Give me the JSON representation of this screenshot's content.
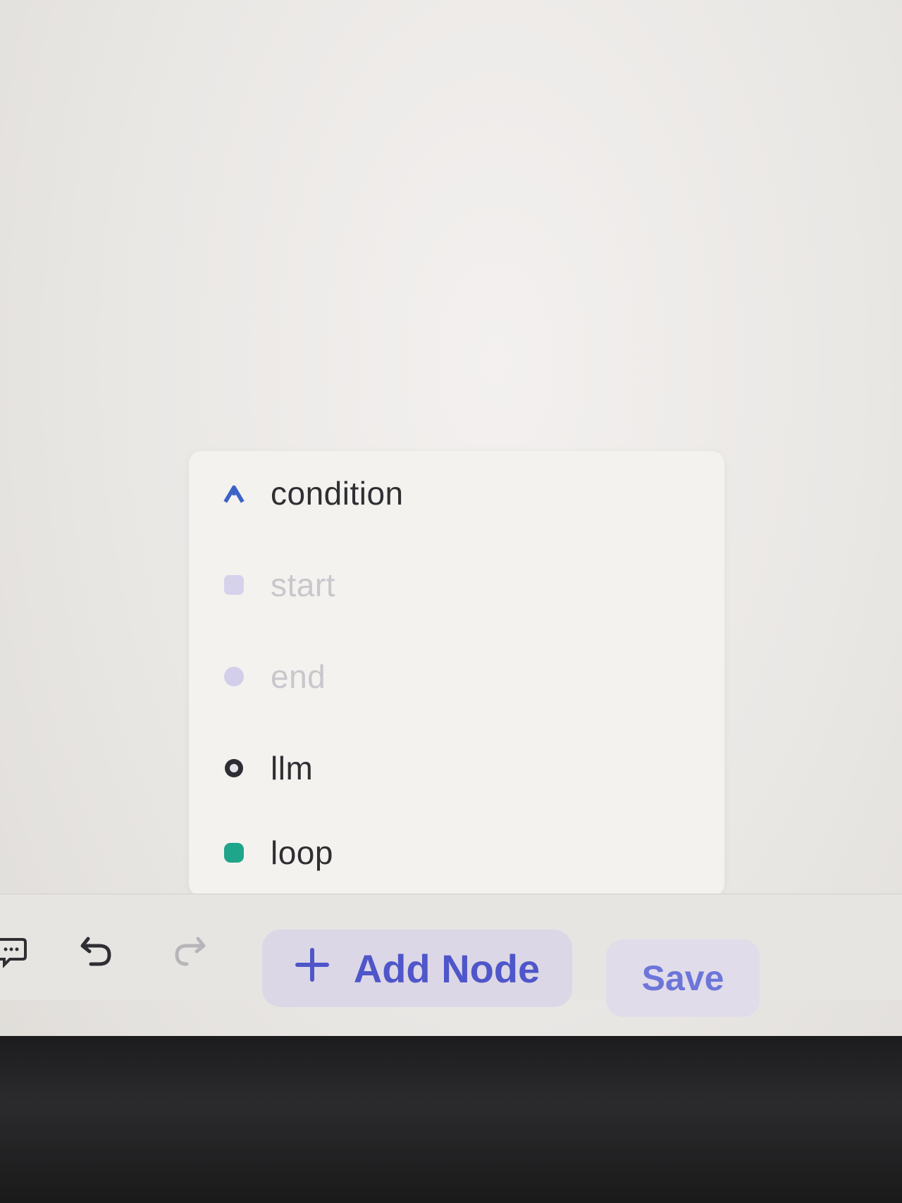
{
  "node_menu": {
    "items": [
      {
        "label": "condition",
        "icon": "branch-up-icon",
        "disabled": false,
        "color": "#3c63c8"
      },
      {
        "label": "start",
        "icon": "square-icon",
        "disabled": true,
        "color": "#cbc6e6"
      },
      {
        "label": "end",
        "icon": "circle-icon",
        "disabled": true,
        "color": "#cbc6e6"
      },
      {
        "label": "llm",
        "icon": "brain-circle-icon",
        "disabled": false,
        "color": "#2d2d33"
      },
      {
        "label": "loop",
        "icon": "loop-icon",
        "disabled": false,
        "color": "#1fa58a"
      }
    ]
  },
  "toolbar": {
    "comment_icon": "comment-icon",
    "undo_icon": "undo-icon",
    "redo_icon": "redo-icon",
    "add_node_label": "Add Node",
    "add_node_icon": "plus-icon",
    "save_label": "Save"
  },
  "colors": {
    "accent": "#4f56c9",
    "save_text": "#6d76d8"
  }
}
